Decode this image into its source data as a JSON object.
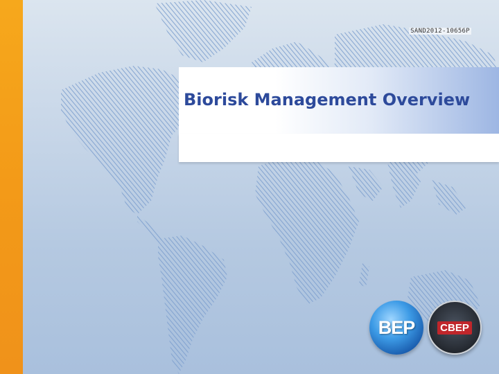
{
  "slide": {
    "ref_code": "SAND2012-10656P",
    "title": "Biorisk Management Overview",
    "subtitle": ""
  },
  "logos": {
    "bep_text": "BEP",
    "cbep_text": "CBEP"
  },
  "colors": {
    "accent_bar": "#f39a18",
    "title_text": "#2d4a9b",
    "background": "#c7d6e8"
  }
}
